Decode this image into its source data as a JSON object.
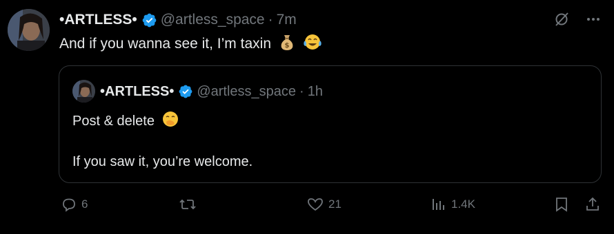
{
  "post": {
    "author_name": "•ARTLESS•",
    "handle": "@artless_space",
    "separator": "·",
    "time": "7m",
    "text": "And if you wanna see it, I’m taxin"
  },
  "quote": {
    "author_name": "•ARTLESS•",
    "handle": "@artless_space",
    "separator": "·",
    "time": "1h",
    "line1": "Post & delete",
    "line2": "If you saw it, you’re welcome."
  },
  "actions": {
    "replies": "6",
    "reposts": "",
    "likes": "21",
    "views": "1.4K"
  },
  "colors": {
    "background": "#000000",
    "text": "#e7e9ea",
    "muted": "#71767b",
    "border": "#2f3336",
    "verified": "#1d9bf0"
  },
  "icons": [
    "verified-badge-icon",
    "grok-icon",
    "more-icon",
    "money-bag-emoji",
    "tears-of-joy-emoji",
    "hand-over-mouth-emoji",
    "reply-icon",
    "repost-icon",
    "like-icon",
    "views-icon",
    "bookmark-icon",
    "share-icon"
  ]
}
